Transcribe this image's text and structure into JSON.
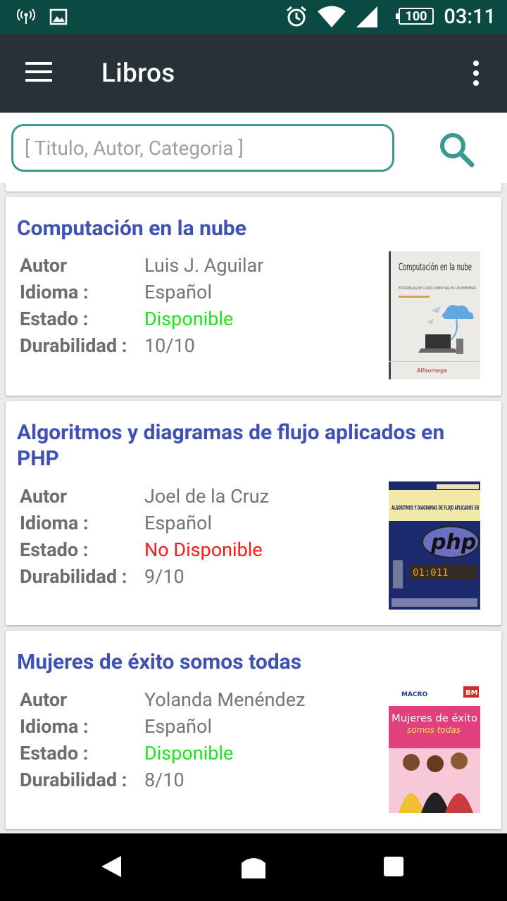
{
  "status_bar": {
    "time": "03:11",
    "battery": "100",
    "icons": [
      "hotspot-icon",
      "image-icon",
      "alarm-icon",
      "wifi-icon",
      "signal-icon",
      "battery-icon"
    ]
  },
  "toolbar": {
    "title": "Libros",
    "menu_icon": "hamburger-menu-icon",
    "overflow_icon": "more-vert-icon"
  },
  "search": {
    "placeholder": "[ Titulo, Autor, Categoria ]",
    "value": "",
    "icon": "search-icon",
    "accent": "#3a9a8e"
  },
  "labels": {
    "author": "Autor",
    "language": "Idioma :",
    "status": "Estado :",
    "durability": "Durabilidad :"
  },
  "colors": {
    "title": "#3f51b5",
    "available": "#22e022",
    "unavailable": "#ff1a1a"
  },
  "books": [
    {
      "title": "Computación en la nube",
      "author": "Luis J. Aguilar",
      "language": "Español",
      "status": "Disponible",
      "durability": "10/10",
      "cover": {
        "title": "Computación en la nube",
        "subtitle": "ESTRATEGIAS DE CLOUD COMPUTING EN LAS EMPRESAS",
        "publisher": "Alfaomega"
      }
    },
    {
      "title": "Algoritmos y diagramas de flujo aplicados en PHP",
      "author": "Joel de la Cruz",
      "language": "Español",
      "status": "No Disponible",
      "durability": "9/10",
      "cover": {
        "title": "ALGORITMOS Y DIAGRAMAS DE FLUJO APLICADOS EN",
        "logo": "php"
      }
    },
    {
      "title": "Mujeres de éxito somos todas",
      "author": "Yolanda Menéndez",
      "language": "Español",
      "status": "Disponible",
      "durability": "8/10",
      "cover": {
        "brand": "MACRO",
        "badge": "BM",
        "title1": "Mujeres de éxito",
        "title2": "somos todas"
      }
    }
  ],
  "nav_bar": {
    "icons": [
      "back-icon",
      "home-icon",
      "recents-icon"
    ]
  }
}
